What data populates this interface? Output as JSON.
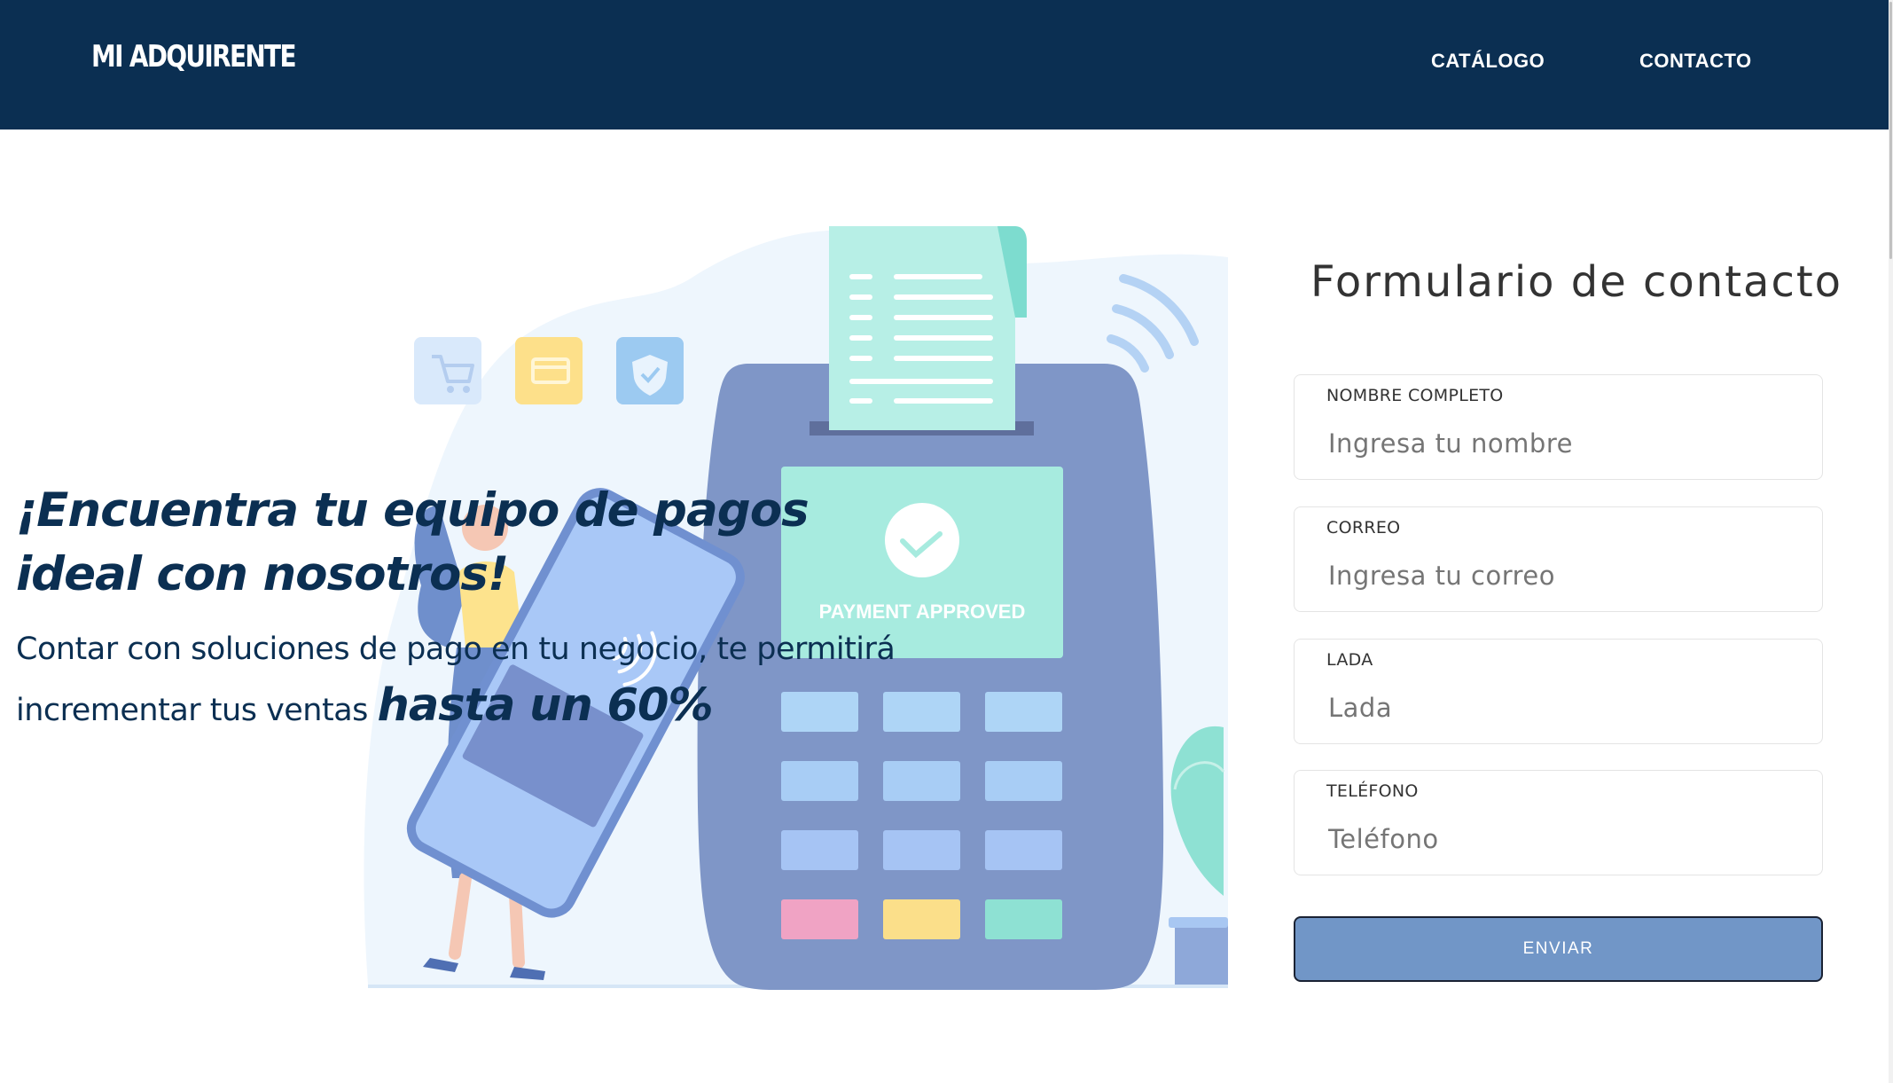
{
  "header": {
    "brand": "MI ADQUIRENTE",
    "nav": [
      {
        "label": "CATÁLOGO"
      },
      {
        "label": "CONTACTO"
      }
    ]
  },
  "hero": {
    "title": "¡Encuentra tu equipo de pagos ideal con nosotros!",
    "subtitle": "Contar con soluciones de pago en tu negocio, te permitirá incrementar tus ventas",
    "highlight": "hasta un 60%",
    "illustration": {
      "screen_text": "PAYMENT APPROVED",
      "icons": [
        "cart-icon",
        "card-icon",
        "shield-check-icon",
        "wifi-signal-icon",
        "check-icon"
      ]
    }
  },
  "form": {
    "title": "Formulario de contacto",
    "fields": [
      {
        "label": "NOMBRE COMPLETO",
        "placeholder": "Ingresa tu nombre",
        "value": ""
      },
      {
        "label": "CORREO",
        "placeholder": "Ingresa tu correo",
        "value": ""
      },
      {
        "label": "LADA",
        "placeholder": "Lada",
        "value": ""
      },
      {
        "label": "TELÉFONO",
        "placeholder": "Teléfono",
        "value": ""
      }
    ],
    "submit_label": "ENVIAR"
  },
  "colors": {
    "navbar": "#0b2f52",
    "heading": "#0b2f52",
    "button": "#7196c7",
    "terminal": "#7f96c7",
    "screen": "#a7ebdf"
  }
}
